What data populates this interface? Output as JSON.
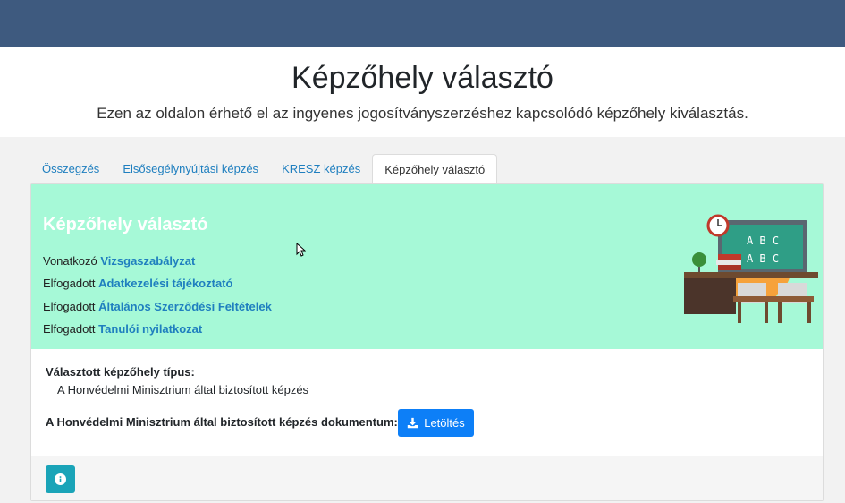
{
  "hero": {
    "title": "Képzőhely választó",
    "subtitle": "Ezen az oldalon érhető el az ingyenes jogosítványszerzéshez kapcsolódó képzőhely kiválasztás."
  },
  "tabs": [
    {
      "label": "Összegzés",
      "active": false
    },
    {
      "label": "Elsősegélynyújtási képzés",
      "active": false
    },
    {
      "label": "KRESZ képzés",
      "active": false
    },
    {
      "label": "Képzőhely választó",
      "active": true
    }
  ],
  "panel": {
    "heading": "Képzőhely választó",
    "lines": [
      {
        "prefix": "Vonatkozó",
        "link": "Vizsgaszabályzat"
      },
      {
        "prefix": "Elfogadott",
        "link": "Adatkezelési tájékoztató"
      },
      {
        "prefix": "Elfogadott",
        "link": "Általános Szerződési Feltételek"
      },
      {
        "prefix": "Elfogadott",
        "link": "Tanulói nyilatkozat"
      }
    ],
    "board_text": [
      "A B C",
      "A B C"
    ]
  },
  "details": {
    "selected_label": "Választott képzőhely típus:",
    "selected_value": "A Honvédelmi Minisztrium által biztosított képzés",
    "document_label": "A Honvédelmi Minisztrium által biztosított képzés dokumentum:",
    "download_label": "Letöltés"
  },
  "icons": {
    "download": "download-icon",
    "info": "info-icon"
  },
  "colors": {
    "topbar": "#3e5a7f",
    "panel_bg": "#a6f9d7",
    "link": "#1f7fbf",
    "primary_button": "#0d7ff7",
    "info_button": "#1aa4b8"
  }
}
